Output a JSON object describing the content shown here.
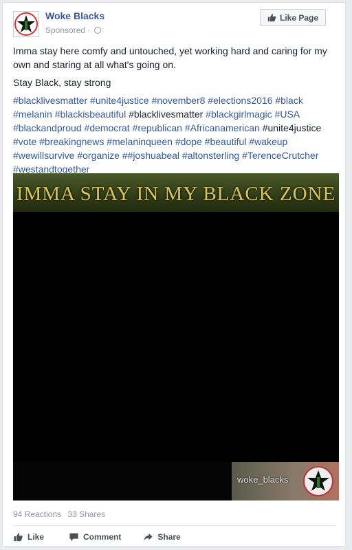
{
  "post": {
    "page_name": "Woke Blacks",
    "sponsored": "Sponsored ·",
    "like_page_label": "Like Page",
    "text_line1": "Imma stay here comfy and untouched, yet working hard and caring for my own and staring at all what's going on.",
    "text_line2": "Stay Black, stay strong",
    "hashtags": [
      {
        "t": "#blacklivesmatter",
        "plain": false
      },
      {
        "t": "#unite4justice",
        "plain": false
      },
      {
        "t": "#november8",
        "plain": false
      },
      {
        "t": "#elections2016",
        "plain": false
      },
      {
        "t": "#black",
        "plain": false
      },
      {
        "t": "#melanin",
        "plain": false
      },
      {
        "t": "#blackisbeautiful",
        "plain": false
      },
      {
        "t": "#blacklivesmatter",
        "plain": true
      },
      {
        "t": "#blackgirlmagic",
        "plain": false
      },
      {
        "t": "#USA",
        "plain": false
      },
      {
        "t": "#blackandproud",
        "plain": false
      },
      {
        "t": "#democrat",
        "plain": false
      },
      {
        "t": "#republican",
        "plain": false
      },
      {
        "t": "#Africanamerican",
        "plain": false
      },
      {
        "t": "#unite4justice",
        "plain": true
      },
      {
        "t": "#vote",
        "plain": false
      },
      {
        "t": "#breakingnews",
        "plain": false
      },
      {
        "t": "#melaninqueen",
        "plain": false
      },
      {
        "t": "#dope",
        "plain": false
      },
      {
        "t": "#beautiful",
        "plain": false
      },
      {
        "t": "#wakeup",
        "plain": false
      },
      {
        "t": "#wewillsurvive",
        "plain": false
      },
      {
        "t": "#organize",
        "plain": false
      },
      {
        "t": "##joshuabeal",
        "plain": false
      },
      {
        "t": "#altonsterling",
        "plain": false
      },
      {
        "t": "#TerenceCrutcher",
        "plain": false
      },
      {
        "t": "#westandtogether",
        "plain": false
      }
    ],
    "image_banner": "IMMA STAY IN MY BLACK ZONE",
    "image_watermark": "woke_blacks",
    "reactions": "94 Reactions",
    "shares": "33 Shares"
  },
  "actions": {
    "like": "Like",
    "comment": "Comment",
    "share": "Share"
  },
  "icons": {
    "like": "thumbs-up-icon",
    "comment": "speech-bubble-icon",
    "share": "share-arrow-icon",
    "audience": "globe-icon"
  },
  "colors": {
    "link": "#365899",
    "meta": "#90949c",
    "text": "#1d2129"
  }
}
